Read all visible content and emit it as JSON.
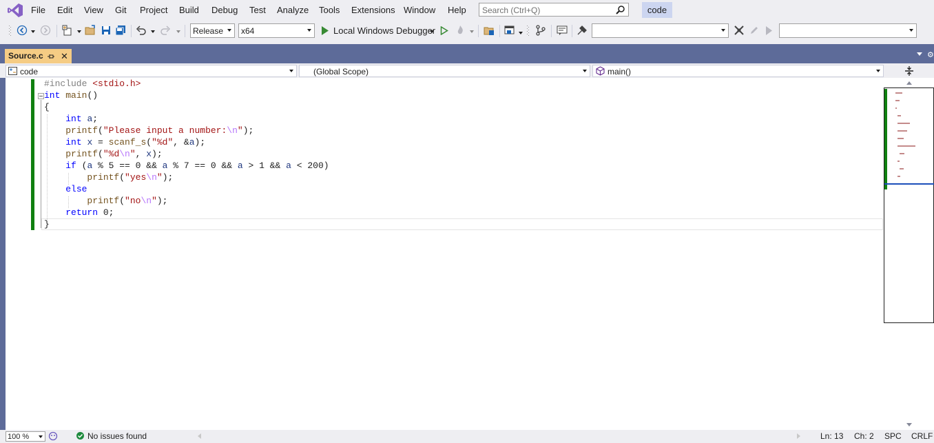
{
  "menubar": {
    "items": [
      "File",
      "Edit",
      "View",
      "Git",
      "Project",
      "Build",
      "Debug",
      "Test",
      "Analyze",
      "Tools",
      "Extensions",
      "Window",
      "Help"
    ],
    "search_placeholder": "Search (Ctrl+Q)",
    "solution_name": "code"
  },
  "toolbar": {
    "configuration": "Release",
    "platform": "x64",
    "debugger_label": "Local Windows Debugger"
  },
  "tabs": [
    {
      "label": "Source.c",
      "active": true
    }
  ],
  "navbar": {
    "project": "code",
    "scope": "(Global Scope)",
    "member": "main()"
  },
  "code_lines": [
    "#include <stdio.h>",
    "int main()",
    "{",
    "    int a;",
    "    printf(\"Please input a number:\\n\");",
    "    int x = scanf_s(\"%d\", &a);",
    "    printf(\"%d\\n\", x);",
    "    if (a % 5 == 0 && a % 7 == 0 && a > 1 && a < 200)",
    "        printf(\"yes\\n\");",
    "    else",
    "        printf(\"no\\n\");",
    "    return 0;",
    "}"
  ],
  "statusbar": {
    "zoom": "100 %",
    "issues": "No issues found",
    "line": "Ln: 13",
    "column": "Ch: 2",
    "whitespace": "SPC",
    "line_ending": "CRLF"
  },
  "colors": {
    "accent": "#5d6b99",
    "tab_active": "#f5cc84",
    "change_bar": "#108010",
    "keyword": "#0000ff",
    "string": "#a31515"
  },
  "icons": [
    "visual-studio-logo-icon",
    "search-icon",
    "back-icon",
    "forward-icon",
    "new-project-icon",
    "open-file-icon",
    "save-icon",
    "save-all-icon",
    "undo-icon",
    "redo-icon",
    "start-debug-icon",
    "start-without-debug-icon",
    "hot-reload-icon",
    "pin-icon",
    "close-icon",
    "split-icon",
    "ok-icon"
  ]
}
